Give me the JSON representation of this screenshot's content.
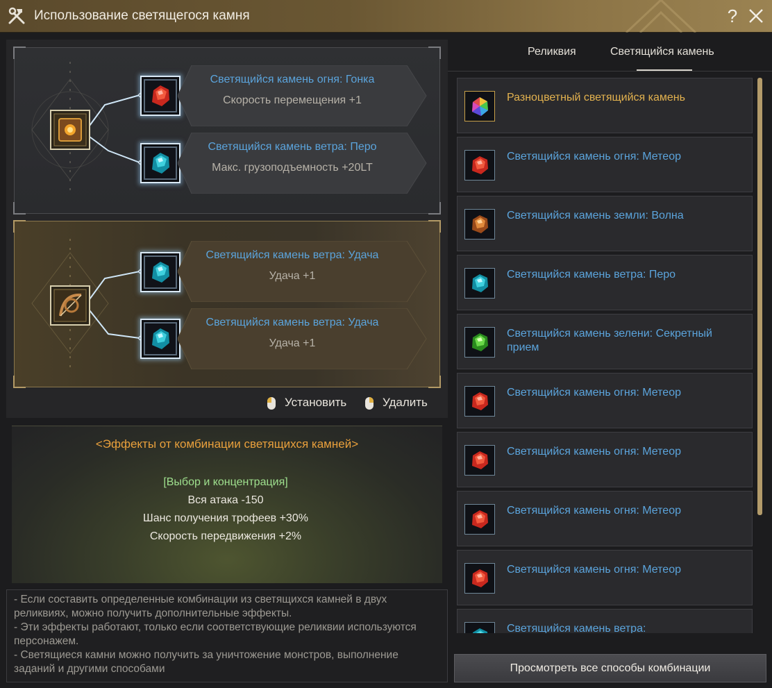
{
  "window": {
    "title": "Использование светящегося камня",
    "help_label": "?",
    "icon": "crossed-tools-icon"
  },
  "relics": [
    {
      "icon": "golden-book-relic-icon",
      "slots": [
        {
          "gem": "fire",
          "name": "Светящийся камень огня: Гонка",
          "effect": "Скорость перемещения +1"
        },
        {
          "gem": "wind",
          "name": "Светящийся камень ветра: Перо",
          "effect": "Макс. грузоподъемность +20LT"
        }
      ]
    },
    {
      "icon": "bronze-bow-relic-icon",
      "slots": [
        {
          "gem": "wind",
          "name": "Светящийся камень ветра: Удача",
          "effect": "Удача +1"
        },
        {
          "gem": "wind",
          "name": "Светящийся камень ветра: Удача",
          "effect": "Удача +1"
        }
      ]
    }
  ],
  "actions": {
    "install_label": "Установить",
    "remove_label": "Удалить"
  },
  "effects": {
    "title": "<Эффекты от комбинации светящихся камней>",
    "combo_name": "[Выбор и концентрация]",
    "lines": [
      "Вся атака -150",
      "Шанс получения трофеев +30%",
      "Скорость передвижения +2%"
    ]
  },
  "notes": [
    "- Если составить определенные комбинации из светящихся камней в двух реликвиях, можно получить дополнительные эффекты.",
    "- Эти эффекты работают, только если соответствующие реликвии используются персонажем.",
    "- Светящиеся камни можно получить за уничтожение монстров, выполнение заданий и другими способами"
  ],
  "tabs": {
    "relic": "Реликвия",
    "glowstone": "Светящийся камень",
    "active": "glowstone"
  },
  "inventory": [
    {
      "gem": "rainbow",
      "name": "Разноцветный светящийся камень"
    },
    {
      "gem": "fire",
      "name": "Светящийся камень огня: Метеор"
    },
    {
      "gem": "earth",
      "name": "Светящийся камень земли: Волна"
    },
    {
      "gem": "wind",
      "name": "Светящийся камень ветра: Перо"
    },
    {
      "gem": "green",
      "name": "Светящийся камень зелени: Секретный прием"
    },
    {
      "gem": "fire",
      "name": "Светящийся камень огня: Метеор"
    },
    {
      "gem": "fire",
      "name": "Светящийся камень огня: Метеор"
    },
    {
      "gem": "fire",
      "name": "Светящийся камень огня: Метеор"
    },
    {
      "gem": "fire",
      "name": "Светящийся камень огня: Метеор"
    },
    {
      "gem": "wind",
      "name": "Светящийся камень ветра:"
    }
  ],
  "view_all_label": "Просмотреть все способы комбинации",
  "colors": {
    "gem_name": "#5ba4dc",
    "rainbow_name": "#e3b24f",
    "effects_title": "#e9a03c",
    "combo_name": "#9fe08e",
    "fire": "#d8392a",
    "wind": "#2fb7c9",
    "earth": "#c9743a",
    "green": "#49b838"
  }
}
